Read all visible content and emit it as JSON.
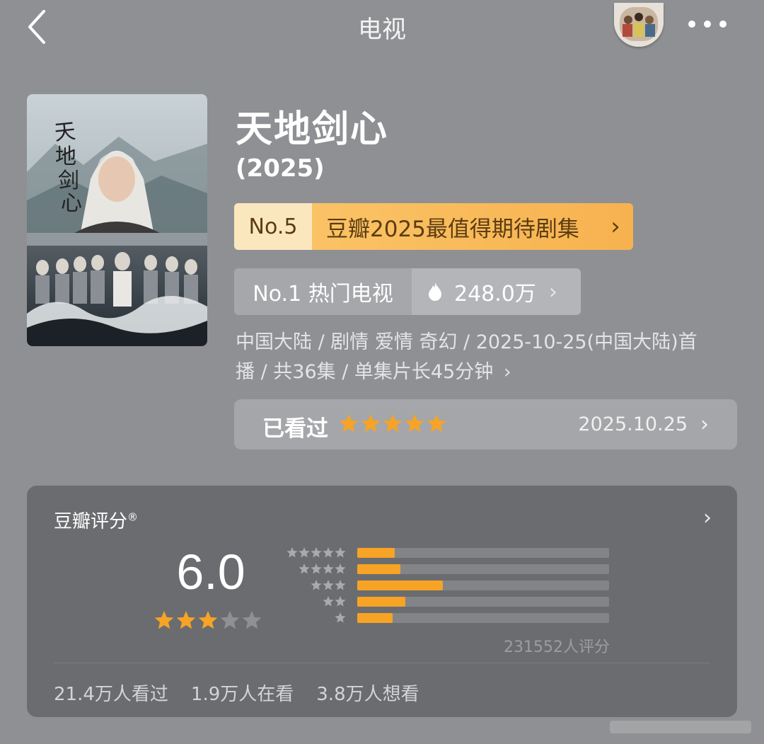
{
  "header": {
    "title": "电视",
    "back_icon": "chevron-left-icon",
    "more_icon": "more-horizontal-icon"
  },
  "show": {
    "title": "天地剑心",
    "year": "(2025)",
    "poster_calligraphy": "天地剑心"
  },
  "rank_banner": {
    "rank": "No.5",
    "label": "豆瓣2025最值得期待剧集",
    "chevron": "›"
  },
  "hot": {
    "rank_label": "No.1 热门电视",
    "count": "248.0万",
    "icon": "fire-icon",
    "chevron": "›"
  },
  "meta": {
    "line1": "中国大陆 / 剧情 爱情 奇幻 / 2025-10-25(中国大陆)首",
    "line2": "播 / 共36集 / 单集片长45分钟",
    "chevron": "›"
  },
  "watched": {
    "label": "已看过",
    "user_stars": 5,
    "date": "2025.10.25",
    "chevron": "›"
  },
  "rating": {
    "title": "豆瓣评分",
    "title_mark": "®",
    "chevron": "›",
    "score": "6.0",
    "stars": 3,
    "distribution": [
      {
        "stars": 5,
        "fraction": 0.15
      },
      {
        "stars": 4,
        "fraction": 0.17
      },
      {
        "stars": 3,
        "fraction": 0.34
      },
      {
        "stars": 2,
        "fraction": 0.19
      },
      {
        "stars": 1,
        "fraction": 0.14
      }
    ],
    "count": "231552人评分",
    "stats": [
      "21.4万人看过",
      "1.9万人在看",
      "3.8万人想看"
    ]
  },
  "colors": {
    "background": "#8f9093",
    "accent_orange": "#f6a326",
    "card": "#6b6c6f"
  }
}
